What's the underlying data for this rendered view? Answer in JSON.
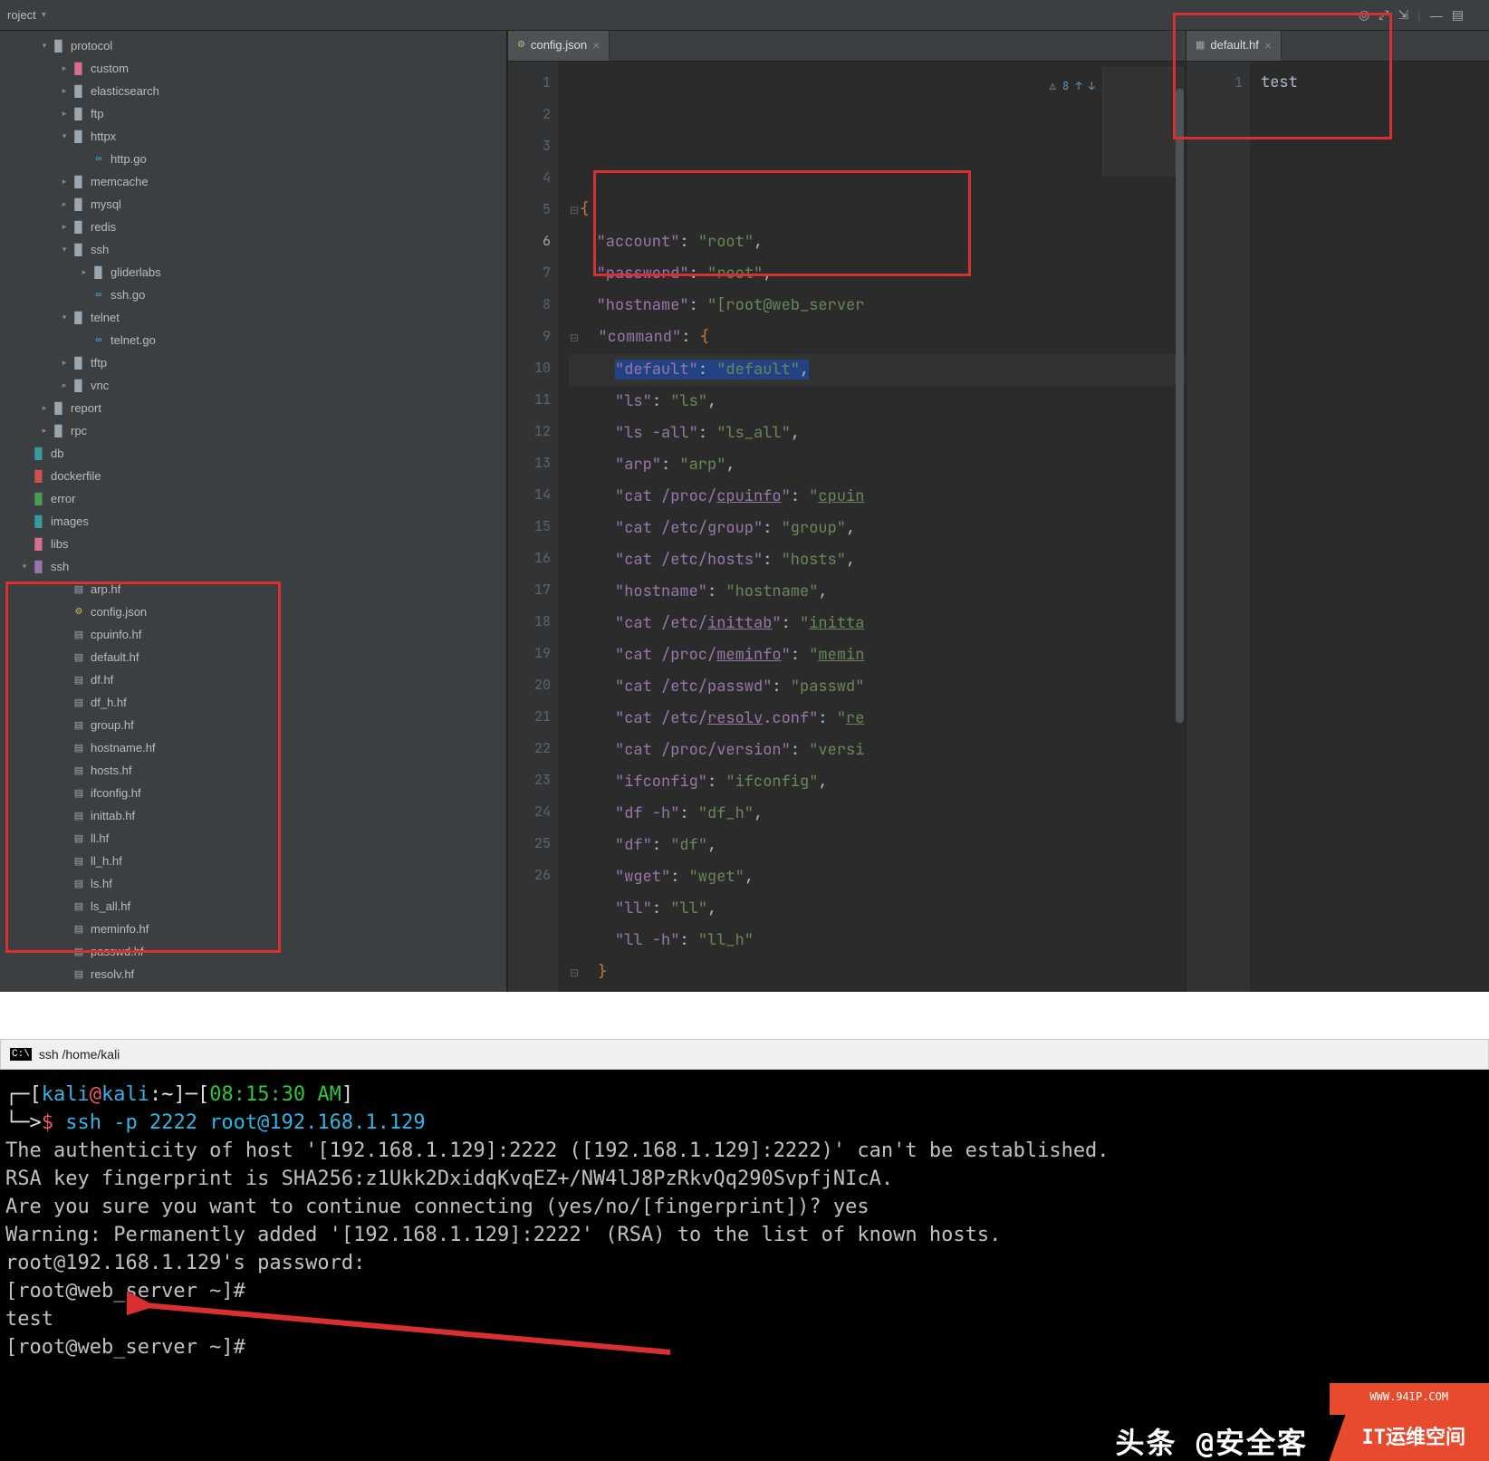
{
  "topbar": {
    "project_label": "roject",
    "dropdown_arrow": "▾"
  },
  "tree": [
    {
      "depth": 0,
      "arrow": "▾",
      "icon": "folder",
      "color": "folder-grey",
      "label": "protocol"
    },
    {
      "depth": 1,
      "arrow": "▸",
      "icon": "folder",
      "color": "pink",
      "label": "custom"
    },
    {
      "depth": 1,
      "arrow": "▸",
      "icon": "folder",
      "color": "folder-grey",
      "label": "elasticsearch"
    },
    {
      "depth": 1,
      "arrow": "▸",
      "icon": "folder",
      "color": "folder-grey",
      "label": "ftp"
    },
    {
      "depth": 1,
      "arrow": "▾",
      "icon": "folder",
      "color": "folder-grey",
      "label": "httpx"
    },
    {
      "depth": 2,
      "arrow": "",
      "icon": "go",
      "color": "go-icon",
      "label": "http.go"
    },
    {
      "depth": 1,
      "arrow": "▸",
      "icon": "folder",
      "color": "folder-grey",
      "label": "memcache"
    },
    {
      "depth": 1,
      "arrow": "▸",
      "icon": "folder",
      "color": "folder-grey",
      "label": "mysql"
    },
    {
      "depth": 1,
      "arrow": "▸",
      "icon": "folder",
      "color": "folder-grey",
      "label": "redis"
    },
    {
      "depth": 1,
      "arrow": "▾",
      "icon": "folder",
      "color": "folder-grey",
      "label": "ssh"
    },
    {
      "depth": 2,
      "arrow": "▸",
      "icon": "folder",
      "color": "folder-grey",
      "label": "gliderlabs"
    },
    {
      "depth": 2,
      "arrow": "",
      "icon": "go",
      "color": "go-icon",
      "label": "ssh.go"
    },
    {
      "depth": 1,
      "arrow": "▾",
      "icon": "folder",
      "color": "folder-grey",
      "label": "telnet"
    },
    {
      "depth": 2,
      "arrow": "",
      "icon": "go",
      "color": "go-icon",
      "label": "telnet.go"
    },
    {
      "depth": 1,
      "arrow": "▸",
      "icon": "folder",
      "color": "folder-grey",
      "label": "tftp"
    },
    {
      "depth": 1,
      "arrow": "▸",
      "icon": "folder",
      "color": "folder-grey",
      "label": "vnc"
    },
    {
      "depth": 0,
      "arrow": "▸",
      "icon": "folder",
      "color": "folder-grey",
      "label": "report"
    },
    {
      "depth": 0,
      "arrow": "▸",
      "icon": "folder",
      "color": "folder-grey",
      "label": "rpc"
    },
    {
      "depth": -1,
      "arrow": "",
      "icon": "folder",
      "color": "teal",
      "label": "db"
    },
    {
      "depth": -1,
      "arrow": "",
      "icon": "folder",
      "color": "red",
      "label": "dockerfile"
    },
    {
      "depth": -1,
      "arrow": "",
      "icon": "folder",
      "color": "green",
      "label": "error"
    },
    {
      "depth": -1,
      "arrow": "",
      "icon": "folder",
      "color": "teal",
      "label": "images"
    },
    {
      "depth": -1,
      "arrow": "",
      "icon": "folder",
      "color": "pink",
      "label": "libs"
    },
    {
      "depth": -1,
      "arrow": "▾",
      "icon": "folder",
      "color": "purple",
      "label": "ssh"
    },
    {
      "depth": 1,
      "arrow": "",
      "icon": "file",
      "color": "file-icon",
      "label": "arp.hf"
    },
    {
      "depth": 1,
      "arrow": "",
      "icon": "config",
      "color": "config-icon",
      "label": "config.json"
    },
    {
      "depth": 1,
      "arrow": "",
      "icon": "file",
      "color": "file-icon",
      "label": "cpuinfo.hf"
    },
    {
      "depth": 1,
      "arrow": "",
      "icon": "file",
      "color": "file-icon",
      "label": "default.hf"
    },
    {
      "depth": 1,
      "arrow": "",
      "icon": "file",
      "color": "file-icon",
      "label": "df.hf"
    },
    {
      "depth": 1,
      "arrow": "",
      "icon": "file",
      "color": "file-icon",
      "label": "df_h.hf"
    },
    {
      "depth": 1,
      "arrow": "",
      "icon": "file",
      "color": "file-icon",
      "label": "group.hf"
    },
    {
      "depth": 1,
      "arrow": "",
      "icon": "file",
      "color": "file-icon",
      "label": "hostname.hf"
    },
    {
      "depth": 1,
      "arrow": "",
      "icon": "file",
      "color": "file-icon",
      "label": "hosts.hf"
    },
    {
      "depth": 1,
      "arrow": "",
      "icon": "file",
      "color": "file-icon",
      "label": "ifconfig.hf"
    },
    {
      "depth": 1,
      "arrow": "",
      "icon": "file",
      "color": "file-icon",
      "label": "inittab.hf"
    },
    {
      "depth": 1,
      "arrow": "",
      "icon": "file",
      "color": "file-icon",
      "label": "ll.hf"
    },
    {
      "depth": 1,
      "arrow": "",
      "icon": "file",
      "color": "file-icon",
      "label": "ll_h.hf"
    },
    {
      "depth": 1,
      "arrow": "",
      "icon": "file",
      "color": "file-icon",
      "label": "ls.hf"
    },
    {
      "depth": 1,
      "arrow": "",
      "icon": "file",
      "color": "file-icon",
      "label": "ls_all.hf"
    },
    {
      "depth": 1,
      "arrow": "",
      "icon": "file",
      "color": "file-icon",
      "label": "meminfo.hf"
    },
    {
      "depth": 1,
      "arrow": "",
      "icon": "file",
      "color": "file-icon",
      "label": "passwd.hf"
    },
    {
      "depth": 1,
      "arrow": "",
      "icon": "file",
      "color": "file-icon",
      "label": "resolv.hf"
    }
  ],
  "tabs": {
    "left": "config.json",
    "right": "default.hf"
  },
  "code_left": {
    "lines": [
      {
        "n": 1,
        "html": "<span class='fold-marker'>⊟</span><span class='b'>{</span>"
      },
      {
        "n": 2,
        "html": "   <span class='p'>\"account\"</span>: <span class='s'>\"root\"</span>,"
      },
      {
        "n": 3,
        "html": "   <span class='p'>\"password\"</span>: <span class='s'>\"root\"</span>,"
      },
      {
        "n": 4,
        "html": "   <span class='p'>\"hostname\"</span>: <span class='s'>\"[root@web_server </span>"
      },
      {
        "n": 5,
        "html": "<span class='fold-marker'>⊟</span>  <span class='p'>\"command\"</span>: <span class='b'>{</span>"
      },
      {
        "n": 6,
        "hl": true,
        "html": "     <span class='sel'><span class='p'>\"default\"</span>: <span class='s'>\"default\"</span>,</span>"
      },
      {
        "n": 7,
        "html": "     <span class='p'>\"ls\"</span>: <span class='s'>\"ls\"</span>,"
      },
      {
        "n": 8,
        "html": "     <span class='p'>\"ls -all\"</span>: <span class='s'>\"ls_all\"</span>,"
      },
      {
        "n": 9,
        "html": "     <span class='p'>\"arp\"</span>: <span class='s'>\"arp\"</span>,"
      },
      {
        "n": 10,
        "html": "     <span class='p'>\"cat /proc/<span class='u'>cpuinfo</span>\"</span>: <span class='s'>\"<span class='u'>cpuin</span></span>"
      },
      {
        "n": 11,
        "html": "     <span class='p'>\"cat /etc/group\"</span>: <span class='s'>\"group\"</span>,"
      },
      {
        "n": 12,
        "html": "     <span class='p'>\"cat /etc/hosts\"</span>: <span class='s'>\"hosts\"</span>,"
      },
      {
        "n": 13,
        "html": "     <span class='p'>\"hostname\"</span>: <span class='s'>\"hostname\"</span>,"
      },
      {
        "n": 14,
        "html": "     <span class='p'>\"cat /etc/<span class='u'>inittab</span>\"</span>: <span class='s'>\"<span class='u'>initta</span></span>"
      },
      {
        "n": 15,
        "html": "     <span class='p'>\"cat /proc/<span class='u'>meminfo</span>\"</span>: <span class='s'>\"<span class='u'>memin</span></span>"
      },
      {
        "n": 16,
        "html": "     <span class='p'>\"cat /etc/passwd\"</span>: <span class='s'>\"passwd\"</span>"
      },
      {
        "n": 17,
        "html": "     <span class='p'>\"cat /etc/<span class='u'>resolv</span>.conf\"</span>: <span class='s'>\"<span class='u'>re</span></span>"
      },
      {
        "n": 18,
        "html": "     <span class='p'>\"cat /proc/version\"</span>: <span class='s'>\"versi</span>"
      },
      {
        "n": 19,
        "html": "     <span class='p'>\"ifconfig\"</span>: <span class='s'>\"ifconfig\"</span>,"
      },
      {
        "n": 20,
        "html": "     <span class='p'>\"df -h\"</span>: <span class='s'>\"df_h\"</span>,"
      },
      {
        "n": 21,
        "html": "     <span class='p'>\"df\"</span>: <span class='s'>\"df\"</span>,"
      },
      {
        "n": 22,
        "html": "     <span class='p'>\"wget\"</span>: <span class='s'>\"wget\"</span>,"
      },
      {
        "n": 23,
        "html": "     <span class='p'>\"ll\"</span>: <span class='s'>\"ll\"</span>,"
      },
      {
        "n": 24,
        "html": "     <span class='p'>\"ll -h\"</span>: <span class='s'>\"ll_h\"</span>"
      },
      {
        "n": 25,
        "html": "<span class='fold-marker'>⊟</span>  <span class='b'>}</span>"
      },
      {
        "n": 26,
        "html": "<span class='fold-marker'>⊟</span><span class='b'>}</span>"
      }
    ],
    "hint": "⚠ 8 ↑ ↓"
  },
  "code_right": {
    "line_no": "1",
    "content": "test"
  },
  "terminal": {
    "title": "ssh /home/kali",
    "lines": [
      {
        "html": "┌─[<span class='c'>kali</span><span class='r'>@</span><span class='c'>kali</span>:<span class='w'>~</span>]─[<span class='g'>08:15:30 AM</span>]"
      },
      {
        "html": "└─><span class='r'>$</span> <span class='c'>ssh -p 2222 root@192.168.1.129</span>"
      },
      {
        "html": "<span class='d'>The authenticity of host '[192.168.1.129]:2222 ([192.168.1.129]:2222)' can't be established.</span>"
      },
      {
        "html": "<span class='d'>RSA key fingerprint is SHA256:z1Ukk2DxidqKvqEZ+/NW4lJ8PzRkvQq290SvpfjNIcA.</span>"
      },
      {
        "html": "<span class='d'>Are you sure you want to continue connecting (yes/no/[fingerprint])? yes</span>"
      },
      {
        "html": "<span class='d'>Warning: Permanently added '[192.168.1.129]:2222' (RSA) to the list of known hosts.</span>"
      },
      {
        "html": "<span class='d'>root@192.168.1.129's password:</span>"
      },
      {
        "html": "<span class='d'>[root@web_server ~]#</span>"
      },
      {
        "html": "<span class='d'>test</span>"
      },
      {
        "html": "<span class='d'>[root@web_server ~]#</span>"
      }
    ]
  },
  "watermarks": {
    "toutiao": "头条 @安全客",
    "brand": "IT运维空间",
    "brand_sub": "WWW.94IP.COM"
  }
}
